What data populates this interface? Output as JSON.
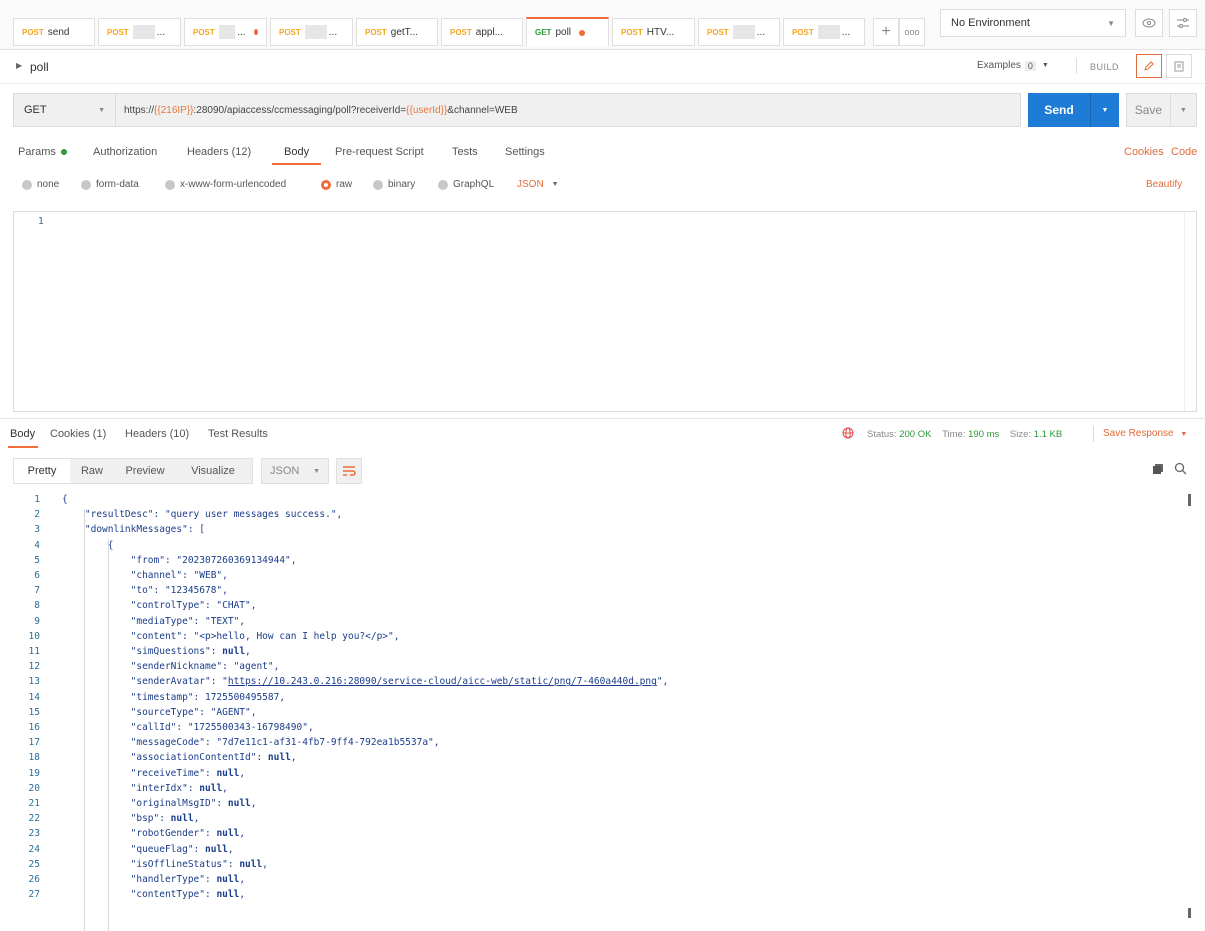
{
  "tabs": [
    {
      "method": "POST",
      "label": "send",
      "blur": false,
      "dot": false,
      "active": false
    },
    {
      "method": "POST",
      "label": "...",
      "blur": true,
      "dot": false,
      "active": false
    },
    {
      "method": "POST",
      "label": "...",
      "blur": true,
      "dot": true,
      "active": false
    },
    {
      "method": "POST",
      "label": "...",
      "blur": true,
      "dot": false,
      "active": false
    },
    {
      "method": "POST",
      "label": "getT...",
      "blur": false,
      "dot": false,
      "active": false
    },
    {
      "method": "POST",
      "label": "appl...",
      "blur": false,
      "dot": false,
      "active": false
    },
    {
      "method": "GET",
      "label": "poll",
      "blur": false,
      "dot": true,
      "active": true
    },
    {
      "method": "POST",
      "label": "HTV...",
      "blur": false,
      "dot": false,
      "active": false
    },
    {
      "method": "POST",
      "label": "...",
      "blur": true,
      "dot": false,
      "active": false
    },
    {
      "method": "POST",
      "label": "...",
      "blur": true,
      "dot": false,
      "active": false
    }
  ],
  "environment": "No Environment",
  "request_name": "poll",
  "examples_label": "Examples",
  "examples_count": "0",
  "build_label": "BUILD",
  "method": "GET",
  "url": {
    "prefix": "https://",
    "var1": "{{216IP}}",
    "mid": ":28090/apiaccess/ccmessaging/poll?receiverId=",
    "var2": "{{userId}}",
    "suffix": "&channel=WEB"
  },
  "send_label": "Send",
  "save_label": "Save",
  "request_tabs": [
    "Params",
    "Authorization",
    "Headers (12)",
    "Body",
    "Pre-request Script",
    "Tests",
    "Settings"
  ],
  "cookies_label": "Cookies",
  "code_label": "Code",
  "body_types": [
    "none",
    "form-data",
    "x-www-form-urlencoded",
    "raw",
    "binary",
    "GraphQL"
  ],
  "body_format": "JSON",
  "beautify_label": "Beautify",
  "editor_line": "1",
  "response_tabs": [
    "Body",
    "Cookies (1)",
    "Headers (10)",
    "Test Results"
  ],
  "status_label": "Status:",
  "status_value": "200 OK",
  "time_label": "Time:",
  "time_value": "190 ms",
  "size_label": "Size:",
  "size_value": "1.1 KB",
  "save_response_label": "Save Response",
  "view_tabs": [
    "Pretty",
    "Raw",
    "Preview",
    "Visualize"
  ],
  "response_format": "JSON",
  "code_lines": [
    "{",
    "    \"resultDesc\": \"query user messages success.\",",
    "    \"downlinkMessages\": [",
    "        {",
    "            \"from\": \"202307260369134944\",",
    "            \"channel\": \"WEB\",",
    "            \"to\": \"12345678\",",
    "            \"controlType\": \"CHAT\",",
    "            \"mediaType\": \"TEXT\",",
    "            \"content\": \"<p>hello, How can I help you?</p>\",",
    "            \"simQuestions\": null,",
    "            \"senderNickname\": \"agent\",",
    "            \"senderAvatar\": \"https://10.243.0.216:28090/service-cloud/aicc-web/static/png/7-460a440d.png\",",
    "            \"timestamp\": 1725500495587,",
    "            \"sourceType\": \"AGENT\",",
    "            \"callId\": \"1725500343-16798490\",",
    "            \"messageCode\": \"7d7e11c1-af31-4fb7-9ff4-792ea1b5537a\",",
    "            \"associationContentId\": null,",
    "            \"receiveTime\": null,",
    "            \"interIdx\": null,",
    "            \"originalMsgID\": null,",
    "            \"bsp\": null,",
    "            \"robotGender\": null,",
    "            \"queueFlag\": null,",
    "            \"isOfflineStatus\": null,",
    "            \"handlerType\": null,",
    "            \"contentType\": null,"
  ]
}
